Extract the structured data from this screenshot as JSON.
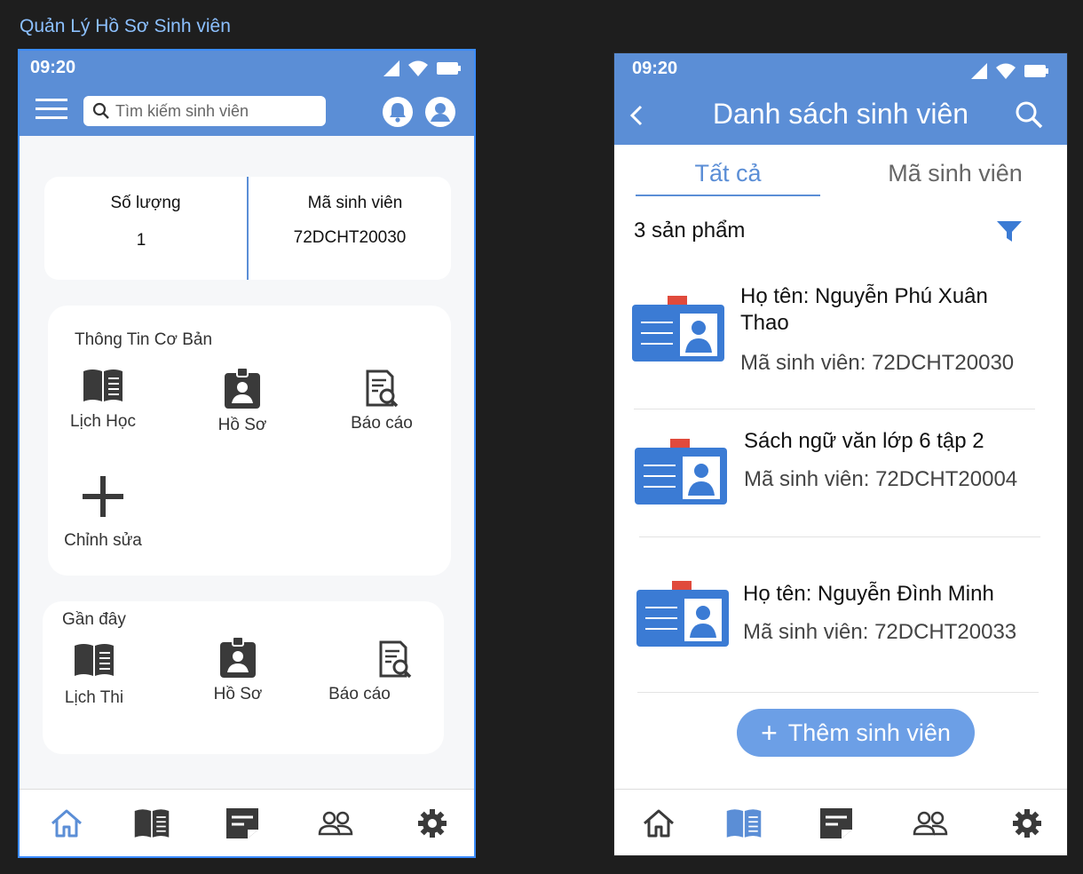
{
  "board_title": "Quản Lý Hồ Sơ Sinh viên",
  "phone1": {
    "status_time": "09:20",
    "search_placeholder": "Tìm kiếm sinh viên",
    "stats": {
      "count_label": "Số  lượng",
      "count_value": "1",
      "code_label": "Mã sinh viên",
      "code_value": "72DCHT20030"
    },
    "basic_info": {
      "title": "Thông Tin Cơ Bản",
      "tiles": [
        {
          "label": "Lịch Học",
          "icon": "book-icon"
        },
        {
          "label": "Hồ Sơ",
          "icon": "id-badge-icon"
        },
        {
          "label": "Báo cáo",
          "icon": "report-search-icon"
        },
        {
          "label": "Chỉnh sửa",
          "icon": "plus-icon"
        }
      ]
    },
    "recent": {
      "title": "Gần đây",
      "tiles": [
        {
          "label": "Lịch Thi",
          "icon": "book-icon"
        },
        {
          "label": "Hồ Sơ",
          "icon": "id-badge-icon"
        },
        {
          "label": "Báo cáo",
          "icon": "report-search-icon"
        }
      ]
    },
    "nav": [
      {
        "icon": "home-icon",
        "active": true
      },
      {
        "icon": "book-icon",
        "active": false
      },
      {
        "icon": "note-icon",
        "active": false
      },
      {
        "icon": "people-icon",
        "active": false
      },
      {
        "icon": "gear-icon",
        "active": false
      }
    ]
  },
  "phone2": {
    "status_time": "09:20",
    "title": "Danh sách sinh viên",
    "tabs": [
      {
        "label": "Tất cả",
        "active": true
      },
      {
        "label": "Mã sinh viên",
        "active": false
      }
    ],
    "count_text": "3 sản phẩm",
    "students": [
      {
        "name": "Họ tên: Nguyễn Phú Xuân Thao",
        "code": "Mã sinh viên: 72DCHT20030"
      },
      {
        "name": "Sách ngữ văn lớp 6 tập 2",
        "code": "Mã sinh viên: 72DCHT20004"
      },
      {
        "name": "Họ tên: Nguyễn Đình Minh",
        "code": "Mã sinh viên: 72DCHT20033"
      }
    ],
    "add_button": "Thêm sinh viên",
    "nav": [
      {
        "icon": "home-icon",
        "active": false
      },
      {
        "icon": "book-icon",
        "active": true
      },
      {
        "icon": "note-icon",
        "active": false
      },
      {
        "icon": "people-icon",
        "active": false
      },
      {
        "icon": "gear-icon",
        "active": false
      }
    ]
  },
  "colors": {
    "primary": "#5b8ed6",
    "accent": "#3b7bd4",
    "badge_red": "#e04a3c",
    "icon_dark": "#3a3a3a"
  }
}
